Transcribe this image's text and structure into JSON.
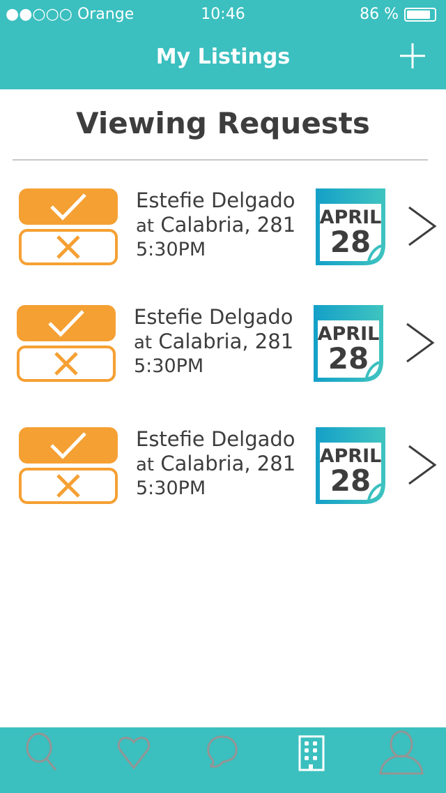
{
  "status_bar": {
    "carrier": "●●○○○ Orange",
    "time": "10:46",
    "battery": "86 %",
    "battery_level": 0.86
  },
  "header": {
    "title": "My Listings",
    "add_icon": "plus-icon"
  },
  "section": {
    "title": "Viewing Requests"
  },
  "requests": [
    {
      "name": "Estefie Delgado",
      "location_prefix": "at",
      "location": "Calabria, 281",
      "time": "5:30PM",
      "month": "APRIL",
      "day": "28"
    },
    {
      "name": "Estefie Delgado",
      "location_prefix": "at",
      "location": "Calabria, 281",
      "time": "5:30PM",
      "month": "APRIL",
      "day": "28"
    },
    {
      "name": "Estefie Delgado",
      "location_prefix": "at",
      "location": "Calabria, 281",
      "time": "5:30PM",
      "month": "APRIL",
      "day": "28"
    }
  ],
  "tabbar": {
    "items": [
      "search-icon",
      "heart-icon",
      "chat-bubble-icon",
      "building-icon",
      "user-icon"
    ],
    "active": "building-icon"
  },
  "colors": {
    "primary": "#3bbfbf",
    "accent": "#f5a033",
    "inactive_icon": "#949494"
  }
}
